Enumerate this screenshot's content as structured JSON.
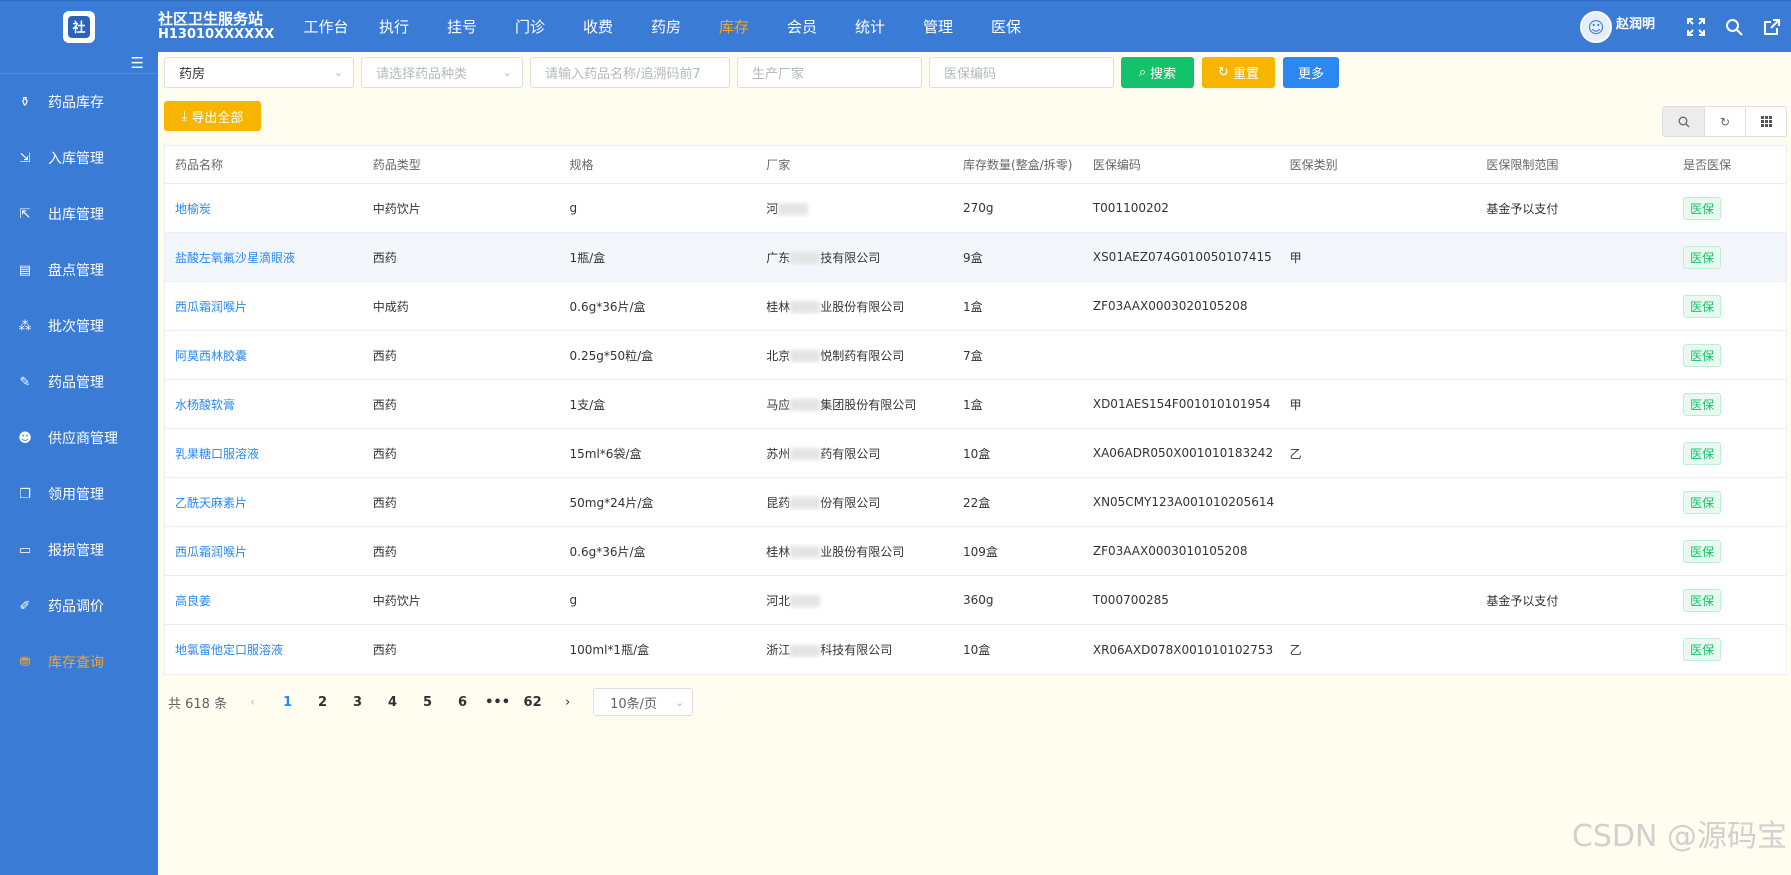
{
  "header": {
    "logo_glyph": "社",
    "brand_title": "社区卫生服务站",
    "brand_code": "H13010XXXXXX",
    "nav": [
      "工作台",
      "执行",
      "挂号",
      "门诊",
      "收费",
      "药房",
      "库存",
      "会员",
      "统计",
      "管理",
      "医保"
    ],
    "active_nav": "库存",
    "username": "赵润明"
  },
  "sidebar": {
    "items": [
      {
        "label": "药品库存",
        "icon": "medicine-bottle-icon"
      },
      {
        "label": "入库管理",
        "icon": "inbound-icon"
      },
      {
        "label": "出库管理",
        "icon": "outbound-icon"
      },
      {
        "label": "盘点管理",
        "icon": "inventory-check-icon"
      },
      {
        "label": "批次管理",
        "icon": "batch-icon"
      },
      {
        "label": "药品管理",
        "icon": "pill-icon"
      },
      {
        "label": "供应商管理",
        "icon": "supplier-icon"
      },
      {
        "label": "领用管理",
        "icon": "requisition-icon"
      },
      {
        "label": "报损管理",
        "icon": "damage-report-icon"
      },
      {
        "label": "药品调价",
        "icon": "price-adjust-icon"
      },
      {
        "label": "库存查询",
        "icon": "stock-query-icon"
      }
    ],
    "active": "库存查询"
  },
  "search": {
    "pharmacy_value": "药房",
    "category_placeholder": "请选择药品种类",
    "name_placeholder": "请输入药品名称/追溯码前7",
    "maker_placeholder": "生产厂家",
    "code_placeholder": "医保编码",
    "search_label": "搜索",
    "reset_label": "重置",
    "more_label": "更多"
  },
  "export_label": "导出全部",
  "table": {
    "columns": [
      "药品名称",
      "药品类型",
      "规格",
      "厂家",
      "库存数量(整盒/拆零)",
      "医保编码",
      "医保类别",
      "医保限制范围",
      "是否医保"
    ],
    "rows": [
      {
        "name": "地榆炭",
        "type": "中药饮片",
        "spec": "g",
        "maker_a": "河",
        "maker_b": "",
        "qty": "270g",
        "code": "T001100202",
        "cat": "",
        "limit": "基金予以支付",
        "flag": "医保"
      },
      {
        "name": "盐酸左氧氟沙星滴眼液",
        "type": "西药",
        "spec": "1瓶/盒",
        "maker_a": "广东",
        "maker_b": "技有限公司",
        "qty": "9盒",
        "code": "XS01AEZ074G010050107415",
        "cat": "甲",
        "limit": "",
        "flag": "医保"
      },
      {
        "name": "西瓜霜润喉片",
        "type": "中成药",
        "spec": "0.6g*36片/盒",
        "maker_a": "桂林",
        "maker_b": "业股份有限公司",
        "qty": "1盒",
        "code": "ZF03AAX0003020105208",
        "cat": "",
        "limit": "",
        "flag": "医保"
      },
      {
        "name": "阿莫西林胶囊",
        "type": "西药",
        "spec": "0.25g*50粒/盒",
        "maker_a": "北京",
        "maker_b": "悦制药有限公司",
        "qty": "7盒",
        "code": "",
        "cat": "",
        "limit": "",
        "flag": "医保"
      },
      {
        "name": "水杨酸软膏",
        "type": "西药",
        "spec": "1支/盒",
        "maker_a": "马应",
        "maker_b": "集团股份有限公司",
        "qty": "1盒",
        "code": "XD01AES154F001010101954",
        "cat": "甲",
        "limit": "",
        "flag": "医保"
      },
      {
        "name": "乳果糖口服溶液",
        "type": "西药",
        "spec": "15ml*6袋/盒",
        "maker_a": "苏州",
        "maker_b": "药有限公司",
        "qty": "10盒",
        "code": "XA06ADR050X001010183242",
        "cat": "乙",
        "limit": "",
        "flag": "医保"
      },
      {
        "name": "乙酰天麻素片",
        "type": "西药",
        "spec": "50mg*24片/盒",
        "maker_a": "昆药",
        "maker_b": "份有限公司",
        "qty": "22盒",
        "code": "XN05CMY123A001010205614",
        "cat": "",
        "limit": "",
        "flag": "医保"
      },
      {
        "name": "西瓜霜润喉片",
        "type": "西药",
        "spec": "0.6g*36片/盒",
        "maker_a": "桂林",
        "maker_b": "业股份有限公司",
        "qty": "109盒",
        "code": "ZF03AAX0003010105208",
        "cat": "",
        "limit": "",
        "flag": "医保"
      },
      {
        "name": "高良姜",
        "type": "中药饮片",
        "spec": "g",
        "maker_a": "河北",
        "maker_b": "",
        "qty": "360g",
        "code": "T000700285",
        "cat": "",
        "limit": "基金予以支付",
        "flag": "医保"
      },
      {
        "name": "地氯雷他定口服溶液",
        "type": "西药",
        "spec": "100ml*1瓶/盒",
        "maker_a": "浙江",
        "maker_b": "科技有限公司",
        "qty": "10盒",
        "code": "XR06AXD078X001010102753",
        "cat": "乙",
        "limit": "",
        "flag": "医保"
      }
    ]
  },
  "pager": {
    "total": "共 618 条",
    "pages": [
      "1",
      "2",
      "3",
      "4",
      "5",
      "6",
      "•••",
      "62"
    ],
    "current": "1",
    "page_size": "10条/页"
  },
  "watermark": "CSDN @源码宝"
}
